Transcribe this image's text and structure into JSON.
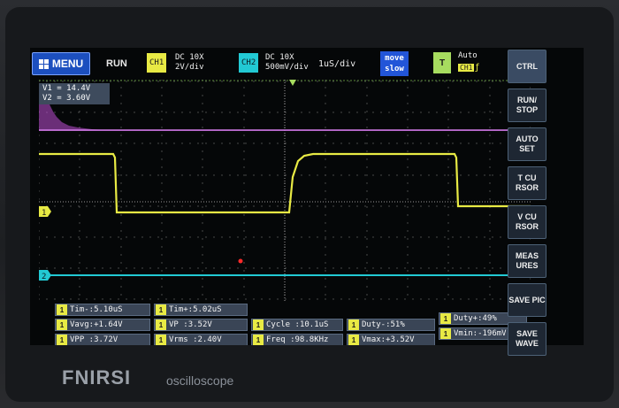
{
  "topbar": {
    "menu_label": "MENU",
    "run_status": "RUN",
    "ch1": {
      "badge": "CH1",
      "coupling": "DC 10X",
      "scale": "2V/div"
    },
    "ch2": {
      "badge": "CH2",
      "coupling": "DC 10X",
      "scale": "500mV/div"
    },
    "timebase": "1uS/div",
    "move_button": {
      "line1": "move",
      "line2": "slow"
    },
    "trigger": {
      "badge": "T",
      "mode": "Auto",
      "source": "CH1"
    }
  },
  "readout": {
    "v1": "V1 = 14.4V",
    "v2": "V2 = 3.60V"
  },
  "markers": {
    "ch1": "1",
    "ch2": "2",
    "trigger": "T"
  },
  "measurements": [
    {
      "label": "Tim-:",
      "value": "5.10uS"
    },
    {
      "label": "Tim+:",
      "value": "5.02uS"
    },
    {
      "label": "Vavg:",
      "value": "+1.64V"
    },
    {
      "label": "VP :",
      "value": "3.52V"
    },
    {
      "label": "Cycle :",
      "value": "10.1uS"
    },
    {
      "label": "Duty-:",
      "value": "51%"
    },
    {
      "label": "Duty+:",
      "value": "49%"
    },
    {
      "label": "VPP :",
      "value": "3.72V"
    },
    {
      "label": "Vrms :",
      "value": "2.40V"
    },
    {
      "label": "Freq :",
      "value": "98.8KHz"
    },
    {
      "label": "Vmax:",
      "value": "+3.52V"
    },
    {
      "label": "Vmin:",
      "value": "-196mV"
    }
  ],
  "sidebar": [
    {
      "label": "CTRL",
      "active": true
    },
    {
      "label": "RUN/ STOP"
    },
    {
      "label": "AUTO SET"
    },
    {
      "label": "T CU RSOR"
    },
    {
      "label": "V CU RSOR"
    },
    {
      "label": "MEAS URES"
    },
    {
      "label": "SAVE PIC"
    },
    {
      "label": "SAVE WAVE"
    }
  ],
  "brand": {
    "name": "FNIRSI",
    "product": "oscilloscope"
  },
  "colors": {
    "ch1": "#e8ea44",
    "ch2": "#22c9d4",
    "fft": "#c04fd6",
    "trigger": "#a7dc5f",
    "menu": "#1c4fbf"
  }
}
